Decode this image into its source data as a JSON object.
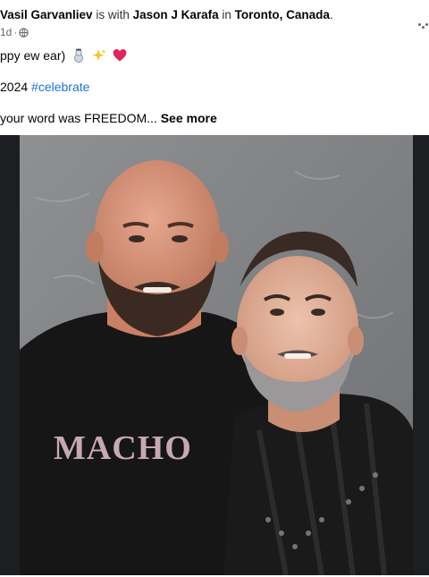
{
  "post": {
    "author": "Vasil Garvanliev",
    "with_text": " is with ",
    "tagged": "Jason J Karafa",
    "in_text": " in ",
    "location": "Toronto, Canada",
    "period": ".",
    "time": "1d",
    "dot": "·",
    "text_line1": "ppy ew ear)",
    "text_line2_prefix": "2024 ",
    "hashtag": "#celebrate",
    "text_line3": "your word was FREEDOM...",
    "see_more": "See more",
    "shirt_text": "MACHO"
  },
  "icons": {
    "privacy": "globe-icon",
    "options": "more-options-icon",
    "emojis": [
      "snowman-icon",
      "sparkles-icon",
      "red-heart-icon"
    ]
  },
  "colors": {
    "link": "#1b74e4",
    "muted": "#65676b",
    "heart": "#e0245e"
  }
}
